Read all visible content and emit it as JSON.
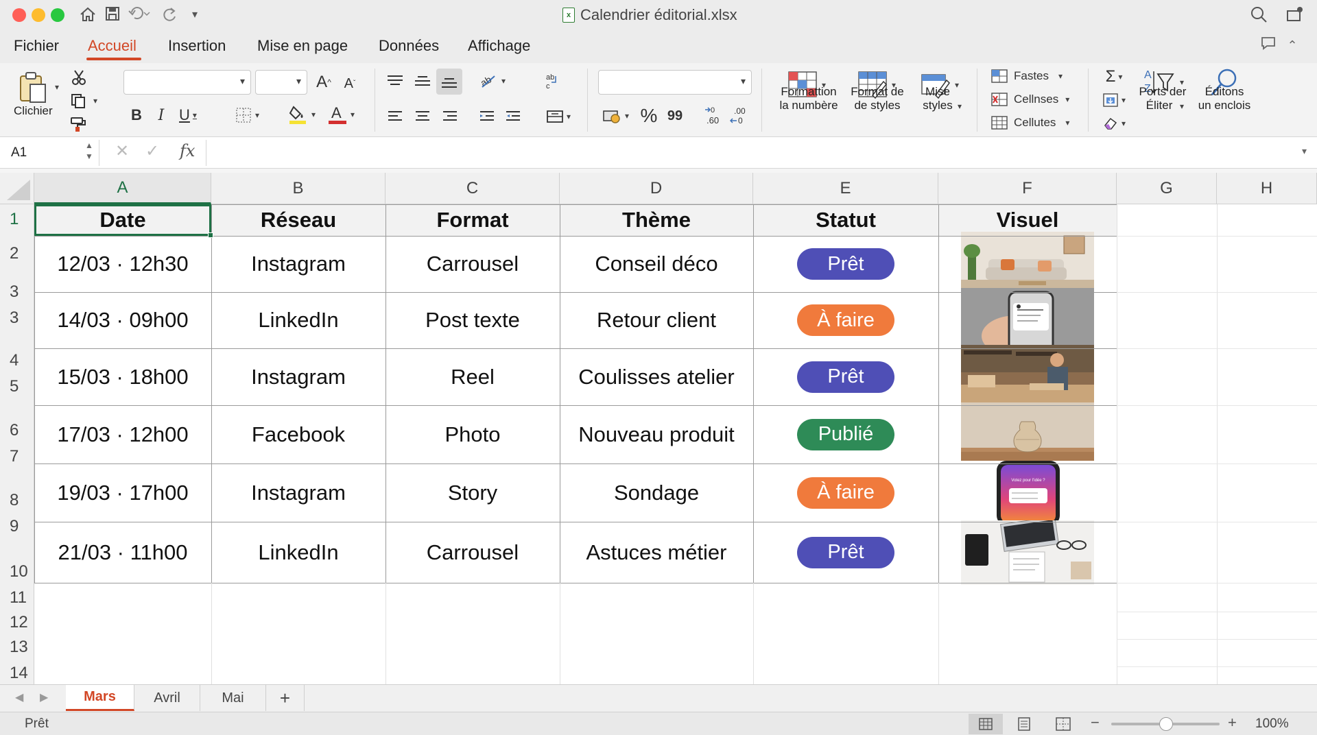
{
  "window": {
    "title": "Calendrier éditorial.xlsx",
    "file_badge": "x"
  },
  "menu": {
    "tabs": [
      "Fichier",
      "Accueil",
      "Insertion",
      "Mise en page",
      "Données",
      "Affichage"
    ],
    "active": "Accueil"
  },
  "ribbon": {
    "clipboard_label": "Clichier",
    "number_format_label_1": "Formattion",
    "number_format_label_2": "la numbère",
    "format_styles_label_1": "Format de",
    "format_styles_label_2": "de styles",
    "mise_styles_label_1": "Mise",
    "mise_styles_label_2": "styles",
    "cells_items": [
      "Fastes",
      "Cellnses",
      "Cellutes"
    ],
    "sort_label_1": "Ports der",
    "sort_label_2": "Éliter",
    "find_label_1": "Éditons",
    "find_label_2": "un enclois",
    "percent": "%",
    "comma": "99",
    "dec_inc": ".60",
    "dec_dec": ".00"
  },
  "formula_bar": {
    "name_box": "A1",
    "fx": "fx",
    "formula": ""
  },
  "sheet": {
    "columns": [
      "A",
      "B",
      "C",
      "D",
      "E",
      "F",
      "G",
      "H"
    ],
    "row_numbers": [
      "1",
      "2",
      "3",
      "3",
      "4",
      "5",
      "6",
      "7",
      "8",
      "9",
      "10",
      "11",
      "12",
      "13",
      "14"
    ],
    "headers": [
      "Date",
      "Réseau",
      "Format",
      "Thème",
      "Statut",
      "Visuel"
    ],
    "rows": [
      {
        "date": "12/03 · 12h30",
        "network": "Instagram",
        "format": "Carrousel",
        "theme": "Conseil déco",
        "status": "Prêt",
        "visual": "living-room-thumbnail"
      },
      {
        "date": "14/03 · 09h00",
        "network": "LinkedIn",
        "format": "Post texte",
        "theme": "Retour client",
        "status": "À faire",
        "visual": "phone-hand-thumbnail"
      },
      {
        "date": "15/03 · 18h00",
        "network": "Instagram",
        "format": "Reel",
        "theme": "Coulisses atelier",
        "status": "Prêt",
        "visual": "workshop-thumbnail"
      },
      {
        "date": "17/03 · 12h00",
        "network": "Facebook",
        "format": "Photo",
        "theme": "Nouveau produit",
        "status": "Publié",
        "visual": "vase-thumbnail"
      },
      {
        "date": "19/03 · 17h00",
        "network": "Instagram",
        "format": "Story",
        "theme": "Sondage",
        "status": "À faire",
        "visual": "phone-story-thumbnail"
      },
      {
        "date": "21/03 · 11h00",
        "network": "LinkedIn",
        "format": "Carrousel",
        "theme": "Astuces métier",
        "status": "Prêt",
        "visual": "desk-laptop-thumbnail"
      }
    ],
    "status_colors": {
      "Prêt": "#4f4fb6",
      "À faire": "#f07a3c",
      "Publié": "#2e8b57"
    },
    "phone_story_text": "Votez pour l'idée ?"
  },
  "sheet_tabs": {
    "tabs": [
      "Mars",
      "Avril",
      "Mai"
    ],
    "active": "Mars",
    "add": "+"
  },
  "status_bar": {
    "status": "Prêt",
    "zoom": "100%"
  },
  "colors": {
    "accent": "#d24726",
    "selection": "#1e7145"
  }
}
